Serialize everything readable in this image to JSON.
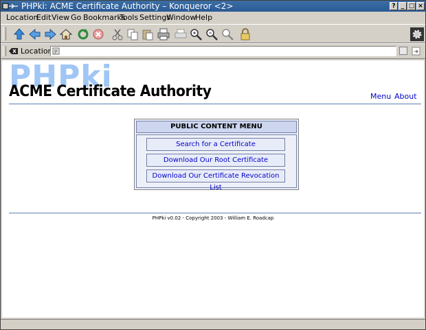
{
  "window": {
    "title": "PHPki: ACME Certificate Authority  – Konqueror <2>",
    "buttons": [
      "?",
      "_",
      "□",
      "×"
    ]
  },
  "menubar": [
    "Location",
    "Edit",
    "View",
    "Go",
    "Bookmarks",
    "Tools",
    "Settings",
    "Window",
    "Help"
  ],
  "toolbar": {
    "icons": [
      "up-arrow-icon",
      "back-arrow-icon",
      "forward-arrow-icon",
      "home-icon",
      "reload-icon",
      "stop-icon",
      "cut-icon",
      "copy-icon",
      "paste-icon",
      "print-icon",
      "print-frame-icon",
      "zoom-in-icon",
      "zoom-out-icon",
      "zoom-icon",
      "lock-icon"
    ]
  },
  "location": {
    "label": "Location",
    "value": ""
  },
  "page": {
    "logo_text": "PHPki",
    "heading": "ACME Certificate Authority",
    "nav": [
      "Menu",
      "About"
    ],
    "menu": {
      "title": "PUBLIC CONTENT MENU",
      "items": [
        "Search for a Certificate",
        "Download Our Root Certificate",
        "Download Our Certificate Revocation List"
      ]
    },
    "footer": "PHPki v0.02 - Copyright 2003 - William E. Roadcap"
  },
  "colors": {
    "link": "#0000cc",
    "logo": "#9fc6f5",
    "titlebar": "#3c6ea5"
  }
}
